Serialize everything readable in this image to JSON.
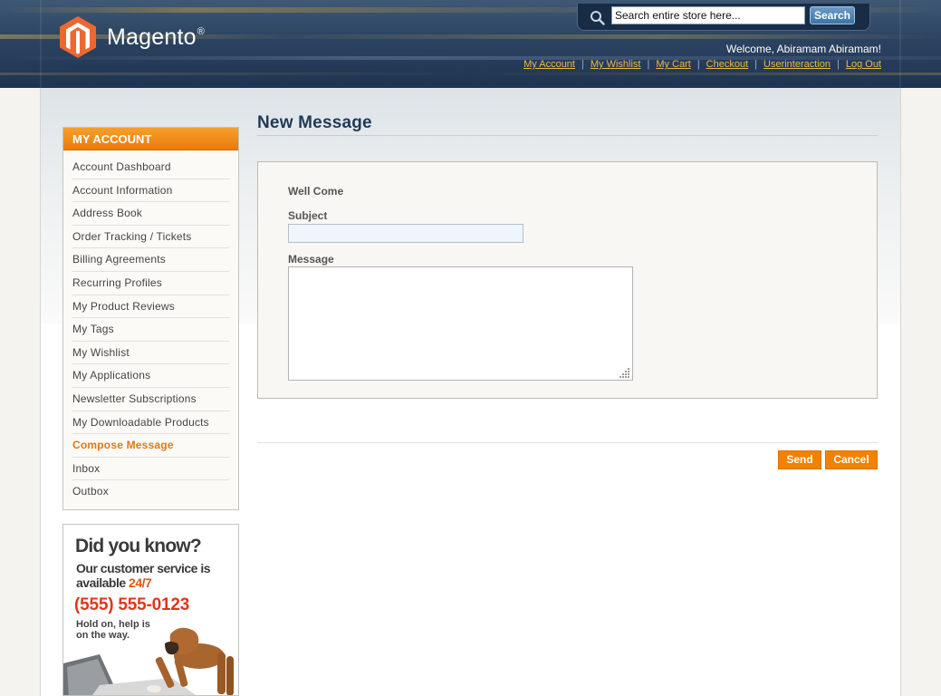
{
  "header": {
    "logo_text": "Magento",
    "logo_reg": "®",
    "search_placeholder": "Search entire store here...",
    "search_button": "Search",
    "welcome": "Welcome, Abiramam Abiramam!",
    "links": [
      "My Account",
      "My Wishlist",
      "My Cart",
      "Checkout",
      "Userinteraction",
      "Log Out"
    ]
  },
  "sidebar": {
    "title": "MY ACCOUNT",
    "items": [
      {
        "label": "Account Dashboard"
      },
      {
        "label": "Account Information"
      },
      {
        "label": "Address Book"
      },
      {
        "label": "Order Tracking / Tickets"
      },
      {
        "label": "Billing Agreements"
      },
      {
        "label": "Recurring Profiles"
      },
      {
        "label": "My Product Reviews"
      },
      {
        "label": "My Tags"
      },
      {
        "label": "My Wishlist"
      },
      {
        "label": "My Applications"
      },
      {
        "label": "Newsletter Subscriptions"
      },
      {
        "label": "My Downloadable Products"
      },
      {
        "label": "Compose Message",
        "active": true
      },
      {
        "label": "Inbox"
      },
      {
        "label": "Outbox"
      }
    ]
  },
  "ad": {
    "title": "Did you know?",
    "line1": "Our customer service is",
    "line2_prefix": "available ",
    "line2_highlight": "24/7",
    "phone": "(555) 555-0123",
    "hold1": "Hold on, help is",
    "hold2": "on the way."
  },
  "content": {
    "page_title": "New Message",
    "form_heading": "Well Come",
    "subject_label": "Subject",
    "subject_value": "",
    "message_label": "Message",
    "message_value": "",
    "send_button": "Send",
    "cancel_button": "Cancel"
  },
  "colors": {
    "accent_orange": "#f18200",
    "header_blue": "#2b4361",
    "link_gold": "#ebbb40",
    "title_blue": "#1f3a58"
  }
}
